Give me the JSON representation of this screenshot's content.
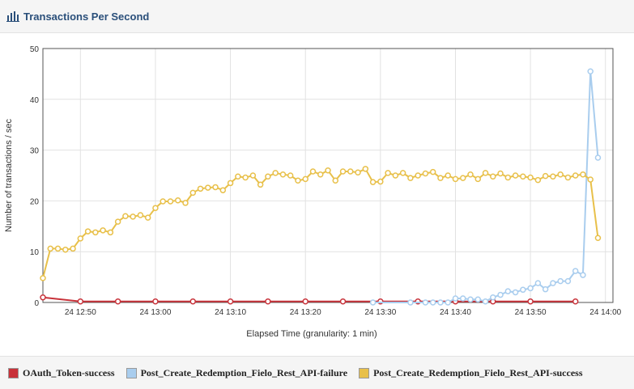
{
  "panel": {
    "title": "Transactions Per Second",
    "icon": "bar-chart-icon"
  },
  "chart_data": {
    "type": "line",
    "title": "",
    "xlabel": "Elapsed Time (granularity: 1 min)",
    "ylabel": "Number of transactions / sec",
    "xlim": [
      "12:45",
      "14:01"
    ],
    "ylim": [
      0,
      50
    ],
    "yticks": [
      0,
      10,
      20,
      30,
      40,
      50
    ],
    "xticks": [
      {
        "t": "12:50",
        "label": "24 12:50"
      },
      {
        "t": "13:00",
        "label": "24 13:00"
      },
      {
        "t": "13:10",
        "label": "24 13:10"
      },
      {
        "t": "13:20",
        "label": "24 13:20"
      },
      {
        "t": "13:30",
        "label": "24 13:30"
      },
      {
        "t": "13:40",
        "label": "24 13:40"
      },
      {
        "t": "13:50",
        "label": "24 13:50"
      },
      {
        "t": "14:00",
        "label": "24 14:00"
      }
    ],
    "grid": true,
    "legend_position": "bottom",
    "series": [
      {
        "name": "OAuth_Token-success",
        "color": "#c8323a",
        "points": [
          [
            "12:45",
            1.0
          ],
          [
            "12:50",
            0.2
          ],
          [
            "12:55",
            0.2
          ],
          [
            "13:00",
            0.2
          ],
          [
            "13:05",
            0.2
          ],
          [
            "13:10",
            0.2
          ],
          [
            "13:15",
            0.2
          ],
          [
            "13:20",
            0.2
          ],
          [
            "13:25",
            0.2
          ],
          [
            "13:30",
            0.2
          ],
          [
            "13:35",
            0.2
          ],
          [
            "13:40",
            0.2
          ],
          [
            "13:45",
            0.2
          ],
          [
            "13:50",
            0.2
          ],
          [
            "13:56",
            0.2
          ]
        ]
      },
      {
        "name": "Post_Create_Redemption_Fielo_Rest_API-failure",
        "color": "#a9cdee",
        "points": [
          [
            "13:29",
            0
          ],
          [
            "13:34",
            0
          ],
          [
            "13:36",
            0
          ],
          [
            "13:37",
            0
          ],
          [
            "13:38",
            0
          ],
          [
            "13:39",
            0
          ],
          [
            "13:40",
            0.8
          ],
          [
            "13:41",
            0.8
          ],
          [
            "13:42",
            0.6
          ],
          [
            "13:43",
            0.6
          ],
          [
            "13:44",
            0.2
          ],
          [
            "13:45",
            1.0
          ],
          [
            "13:46",
            1.5
          ],
          [
            "13:47",
            2.2
          ],
          [
            "13:48",
            2.0
          ],
          [
            "13:49",
            2.5
          ],
          [
            "13:50",
            2.8
          ],
          [
            "13:51",
            3.8
          ],
          [
            "13:52",
            2.6
          ],
          [
            "13:53",
            3.8
          ],
          [
            "13:54",
            4.2
          ],
          [
            "13:55",
            4.2
          ],
          [
            "13:56",
            6.2
          ],
          [
            "13:57",
            5.4
          ],
          [
            "13:58",
            45.5
          ],
          [
            "13:59",
            28.5
          ]
        ]
      },
      {
        "name": "Post_Create_Redemption_Fielo_Rest_API-success",
        "color": "#e8c04a",
        "points": [
          [
            "12:45",
            4.8
          ],
          [
            "12:46",
            10.6
          ],
          [
            "12:47",
            10.6
          ],
          [
            "12:48",
            10.4
          ],
          [
            "12:49",
            10.6
          ],
          [
            "12:50",
            12.6
          ],
          [
            "12:51",
            14.0
          ],
          [
            "12:52",
            13.8
          ],
          [
            "12:53",
            14.2
          ],
          [
            "12:54",
            13.8
          ],
          [
            "12:55",
            15.9
          ],
          [
            "12:56",
            17.0
          ],
          [
            "12:57",
            16.9
          ],
          [
            "12:58",
            17.2
          ],
          [
            "12:59",
            16.7
          ],
          [
            "13:00",
            18.6
          ],
          [
            "13:01",
            19.9
          ],
          [
            "13:02",
            19.9
          ],
          [
            "13:03",
            20.1
          ],
          [
            "13:04",
            19.6
          ],
          [
            "13:05",
            21.6
          ],
          [
            "13:06",
            22.4
          ],
          [
            "13:07",
            22.6
          ],
          [
            "13:08",
            22.7
          ],
          [
            "13:09",
            22.1
          ],
          [
            "13:10",
            23.5
          ],
          [
            "13:11",
            24.8
          ],
          [
            "13:12",
            24.6
          ],
          [
            "13:13",
            25.0
          ],
          [
            "13:14",
            23.2
          ],
          [
            "13:15",
            24.8
          ],
          [
            "13:16",
            25.5
          ],
          [
            "13:17",
            25.2
          ],
          [
            "13:18",
            25.0
          ],
          [
            "13:19",
            24.0
          ],
          [
            "13:20",
            24.3
          ],
          [
            "13:21",
            25.8
          ],
          [
            "13:22",
            25.2
          ],
          [
            "13:23",
            26.0
          ],
          [
            "13:24",
            24.0
          ],
          [
            "13:25",
            25.8
          ],
          [
            "13:26",
            25.8
          ],
          [
            "13:27",
            25.6
          ],
          [
            "13:28",
            26.3
          ],
          [
            "13:29",
            23.7
          ],
          [
            "13:30",
            23.8
          ],
          [
            "13:31",
            25.5
          ],
          [
            "13:32",
            25.0
          ],
          [
            "13:33",
            25.5
          ],
          [
            "13:34",
            24.5
          ],
          [
            "13:35",
            25.0
          ],
          [
            "13:36",
            25.4
          ],
          [
            "13:37",
            25.7
          ],
          [
            "13:38",
            24.5
          ],
          [
            "13:39",
            25.0
          ],
          [
            "13:40",
            24.3
          ],
          [
            "13:41",
            24.5
          ],
          [
            "13:42",
            25.2
          ],
          [
            "13:43",
            24.3
          ],
          [
            "13:44",
            25.5
          ],
          [
            "13:45",
            24.8
          ],
          [
            "13:46",
            25.4
          ],
          [
            "13:47",
            24.6
          ],
          [
            "13:48",
            25.0
          ],
          [
            "13:49",
            24.8
          ],
          [
            "13:50",
            24.6
          ],
          [
            "13:51",
            24.1
          ],
          [
            "13:52",
            24.9
          ],
          [
            "13:53",
            24.8
          ],
          [
            "13:54",
            25.2
          ],
          [
            "13:55",
            24.6
          ],
          [
            "13:56",
            25.0
          ],
          [
            "13:57",
            25.2
          ],
          [
            "13:58",
            24.2
          ],
          [
            "13:59",
            12.7
          ]
        ]
      }
    ]
  }
}
